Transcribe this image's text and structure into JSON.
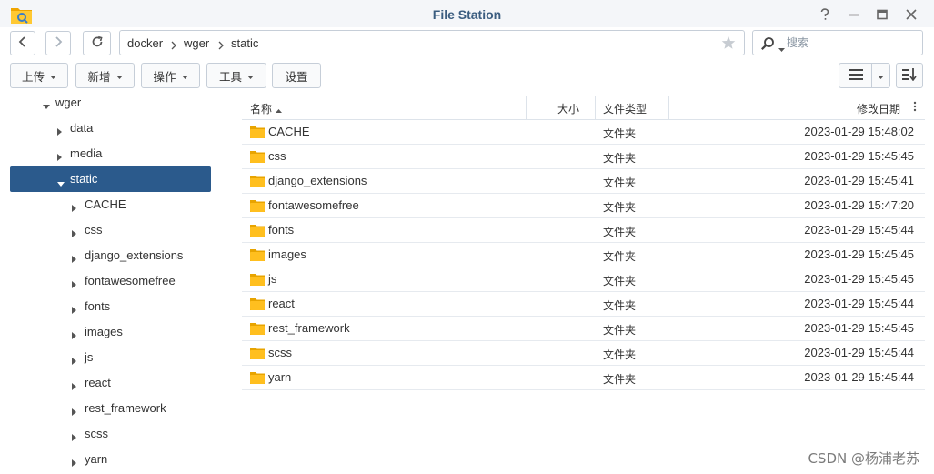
{
  "window": {
    "title": "File Station",
    "help_icon": "help-icon",
    "minimize_icon": "minimize-icon",
    "maximize_icon": "maximize-icon",
    "close_icon": "close-icon"
  },
  "nav": {
    "back_icon": "chevron-left-icon",
    "forward_icon": "chevron-right-icon",
    "refresh_icon": "refresh-icon"
  },
  "path": {
    "crumbs": [
      "docker",
      "wger",
      "static"
    ],
    "favorite_icon": "star-icon"
  },
  "search": {
    "placeholder": "搜索",
    "value": ""
  },
  "toolbar": {
    "upload": "上传",
    "create": "新增",
    "action": "操作",
    "tools": "工具",
    "settings": "设置",
    "view_icon": "list-view-icon",
    "sort_icon": "sort-icon"
  },
  "tree": {
    "root": "wger",
    "items": [
      {
        "label": "data"
      },
      {
        "label": "media"
      },
      {
        "label": "static",
        "selected": true
      },
      {
        "label": "CACHE"
      },
      {
        "label": "css"
      },
      {
        "label": "django_extensions"
      },
      {
        "label": "fontawesomefree"
      },
      {
        "label": "fonts"
      },
      {
        "label": "images"
      },
      {
        "label": "js"
      },
      {
        "label": "react"
      },
      {
        "label": "rest_framework"
      },
      {
        "label": "scss"
      },
      {
        "label": "yarn"
      }
    ]
  },
  "columns": {
    "name": "名称",
    "size": "大小",
    "type": "文件类型",
    "modified": "修改日期"
  },
  "files": [
    {
      "name": "CACHE",
      "type": "文件夹",
      "modified": "2023-01-29 15:48:02"
    },
    {
      "name": "css",
      "type": "文件夹",
      "modified": "2023-01-29 15:45:45"
    },
    {
      "name": "django_extensions",
      "type": "文件夹",
      "modified": "2023-01-29 15:45:41"
    },
    {
      "name": "fontawesomefree",
      "type": "文件夹",
      "modified": "2023-01-29 15:47:20"
    },
    {
      "name": "fonts",
      "type": "文件夹",
      "modified": "2023-01-29 15:45:44"
    },
    {
      "name": "images",
      "type": "文件夹",
      "modified": "2023-01-29 15:45:45"
    },
    {
      "name": "js",
      "type": "文件夹",
      "modified": "2023-01-29 15:45:45"
    },
    {
      "name": "react",
      "type": "文件夹",
      "modified": "2023-01-29 15:45:44"
    },
    {
      "name": "rest_framework",
      "type": "文件夹",
      "modified": "2023-01-29 15:45:45"
    },
    {
      "name": "scss",
      "type": "文件夹",
      "modified": "2023-01-29 15:45:44"
    },
    {
      "name": "yarn",
      "type": "文件夹",
      "modified": "2023-01-29 15:45:44"
    }
  ],
  "watermark": "CSDN @杨浦老苏",
  "colors": {
    "accent": "#2b5a8c",
    "folder": "#f7b500",
    "title": "#3b5d80"
  }
}
